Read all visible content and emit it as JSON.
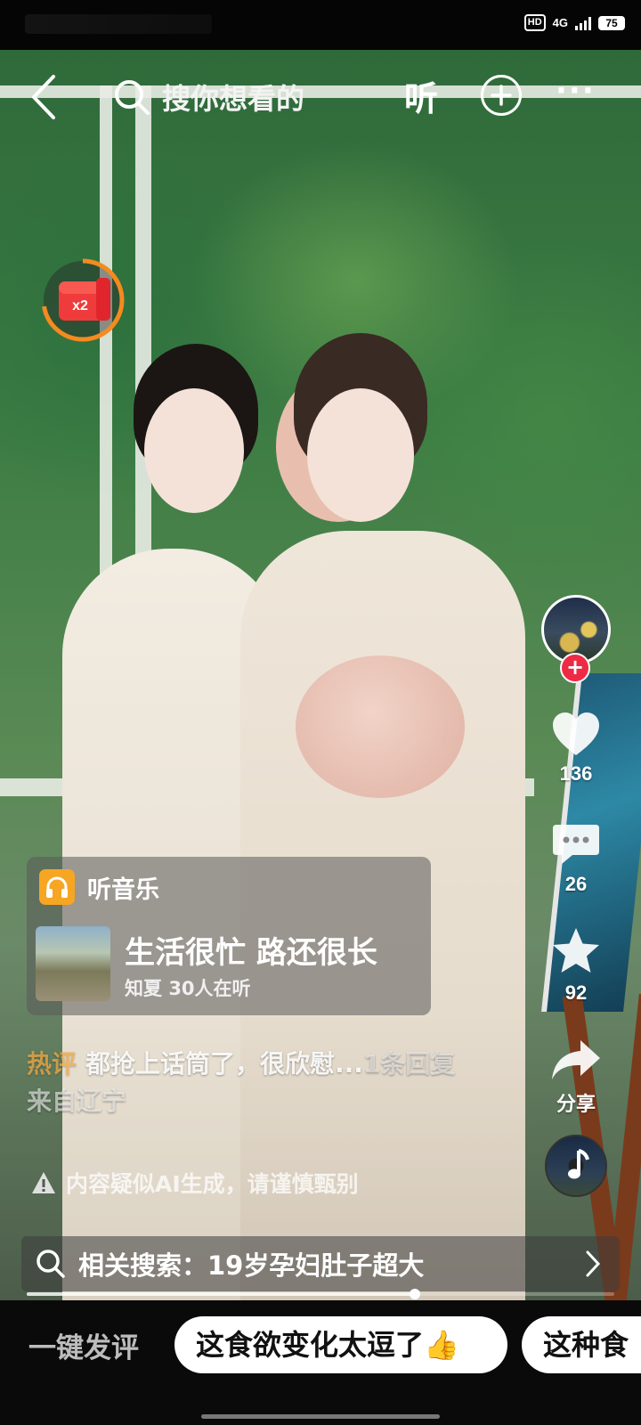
{
  "status_bar": {
    "network": "4G",
    "hd_label": "HD",
    "battery": "75"
  },
  "top_nav": {
    "search_placeholder": "搜你想看的",
    "listen_label": "听"
  },
  "actions": {
    "likes": "136",
    "comments": "26",
    "favorites": "92",
    "share_label": "分享"
  },
  "music_card": {
    "label": "听音乐",
    "song_title": "生活很忙 路还很长",
    "artist": "知夏",
    "listeners": "30人在听"
  },
  "comment": {
    "hot_tag": "热评",
    "text": "都抢上话筒了，很欣慰...",
    "reply_count": "1条回复",
    "location": "来自辽宁"
  },
  "ai_warning": "内容疑似AI生成，请谨慎甄别",
  "related_search": "相关搜索：19岁孕妇肚子超大",
  "progress": {
    "played_fraction": 0.66
  },
  "bottom_bar": {
    "quick_label": "一键发评",
    "chips": [
      "这食欲变化太逗了👍",
      "这种食"
    ]
  },
  "redpack": {
    "multiplier": "x2"
  },
  "colors": {
    "accent_orange": "#f6a623",
    "follow_red": "#ee2a45",
    "hot_tag": "#f0a640"
  }
}
